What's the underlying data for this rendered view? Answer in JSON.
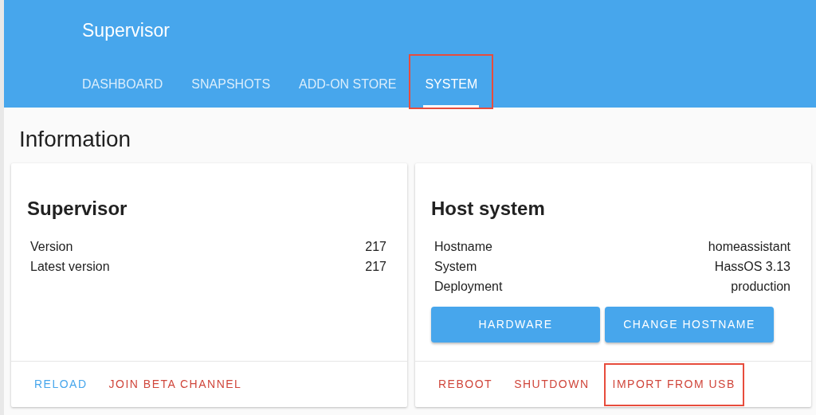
{
  "header": {
    "title": "Supervisor"
  },
  "tabs": [
    {
      "label": "DASHBOARD",
      "selected": false,
      "annotated": false
    },
    {
      "label": "SNAPSHOTS",
      "selected": false,
      "annotated": false
    },
    {
      "label": "ADD-ON STORE",
      "selected": false,
      "annotated": false
    },
    {
      "label": "SYSTEM",
      "selected": true,
      "annotated": true
    }
  ],
  "section_title": "Information",
  "cards": [
    {
      "title": "Supervisor",
      "rows": [
        {
          "label": "Version",
          "value": "217"
        },
        {
          "label": "Latest version",
          "value": "217"
        }
      ],
      "actions": [
        {
          "label": "RELOAD",
          "kind": "primary",
          "annotated": false
        },
        {
          "label": "JOIN BETA CHANNEL",
          "kind": "danger",
          "annotated": false
        }
      ]
    },
    {
      "title": "Host system",
      "rows": [
        {
          "label": "Hostname",
          "value": "homeassistant"
        },
        {
          "label": "System",
          "value": "HassOS 3.13"
        },
        {
          "label": "Deployment",
          "value": "production"
        }
      ],
      "buttons": [
        "HARDWARE",
        "CHANGE HOSTNAME"
      ],
      "actions": [
        {
          "label": "REBOOT",
          "kind": "danger",
          "annotated": false
        },
        {
          "label": "SHUTDOWN",
          "kind": "danger",
          "annotated": false
        },
        {
          "label": "IMPORT FROM USB",
          "kind": "danger",
          "annotated": true
        }
      ]
    }
  ]
}
